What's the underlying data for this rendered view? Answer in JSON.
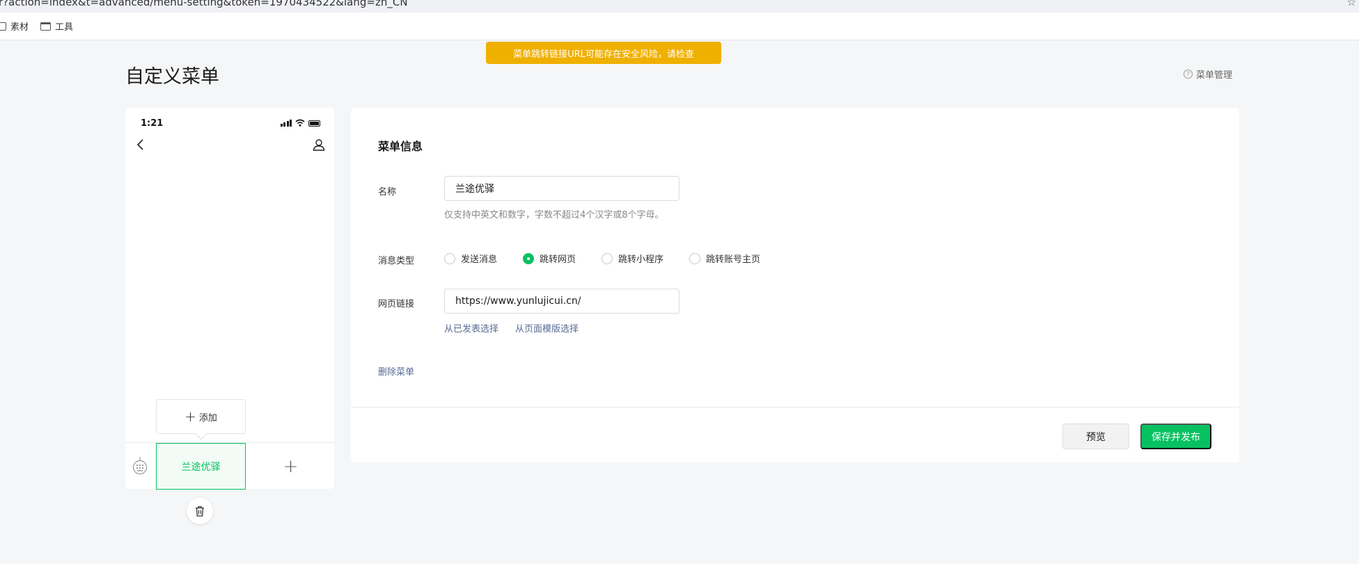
{
  "browser": {
    "url": "r?action=index&t=advanced/menu-setting&token=1970434522&lang=zh_CN",
    "bookmarks": [
      {
        "label": "素材",
        "icon": "bookmark-icon"
      },
      {
        "label": "工具",
        "icon": "folder-icon"
      }
    ]
  },
  "page": {
    "title": "自定义菜单",
    "warning": "菜单跳转链接URL可能存在安全风险，请检查",
    "manage_link": "菜单管理",
    "colors": {
      "accent": "#07c160",
      "warning": "#f0b000",
      "link": "#576b95"
    }
  },
  "phone": {
    "time": "1:21",
    "menu_item": "兰途优驿",
    "submenu_add": "添加",
    "add_symbol": "+"
  },
  "form": {
    "section_title": "菜单信息",
    "name_label": "名称",
    "name_value": "兰途优驿",
    "name_hint": "仅支持中英文和数字，字数不超过4个汉字或8个字母。",
    "type_label": "消息类型",
    "type_options": [
      {
        "label": "发送消息",
        "selected": false
      },
      {
        "label": "跳转网页",
        "selected": true
      },
      {
        "label": "跳转小程序",
        "selected": false
      },
      {
        "label": "跳转账号主页",
        "selected": false
      }
    ],
    "url_label": "网页链接",
    "url_value": "https://www.yunlujicui.cn/",
    "pick_published": "从已发表选择",
    "pick_template": "从页面模版选择",
    "delete_menu": "删除菜单"
  },
  "actions": {
    "preview": "预览",
    "publish": "保存并发布"
  }
}
